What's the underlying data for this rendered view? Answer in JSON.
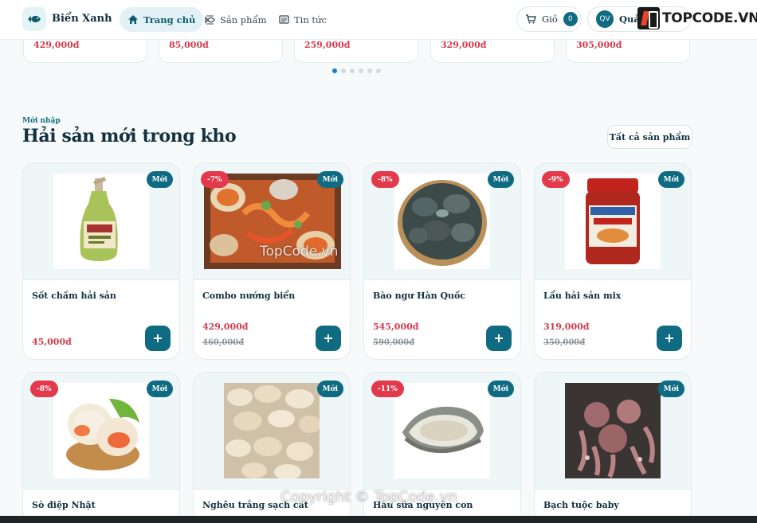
{
  "header": {
    "brand": "Biển Xanh",
    "nav": [
      {
        "label": "Trang chủ",
        "icon": "home-icon"
      },
      {
        "label": "Sản phẩm",
        "icon": "fish-icon"
      },
      {
        "label": "Tin tức",
        "icon": "newspaper-icon"
      }
    ],
    "cart_label": "Giỏ",
    "cart_count": "0",
    "avatar_initials": "QV",
    "user_label": "Quản"
  },
  "watermark": {
    "logo_text": "TOPCODE.VN",
    "center": "TopCode.vn",
    "footer": "Copyright © TopCode.vn"
  },
  "carousel": {
    "prices": [
      "429,000đ",
      "85,000đ",
      "259,000đ",
      "329,000đ",
      "305,000đ"
    ],
    "dot_count": 6,
    "active_dot": 0
  },
  "section": {
    "eyebrow": "Mới nhập",
    "title": "Hải sản mới trong kho",
    "all_button": "Tất cả sản phẩm"
  },
  "colors": {
    "primary": "#0f6b82",
    "sale": "#e2394b",
    "price": "#d43b4d"
  },
  "products": [
    {
      "name": "Sốt chấm hải sản",
      "badge_new": "Mới",
      "discount": "",
      "price": "45,000đ",
      "old_price": ""
    },
    {
      "name": "Combo nướng biển",
      "badge_new": "Mới",
      "discount": "-7%",
      "price": "429,000đ",
      "old_price": "460,000đ"
    },
    {
      "name": "Bào ngư Hàn Quốc",
      "badge_new": "Mới",
      "discount": "-8%",
      "price": "545,000đ",
      "old_price": "590,000đ"
    },
    {
      "name": "Lẩu hải sản mix",
      "badge_new": "Mới",
      "discount": "-9%",
      "price": "319,000đ",
      "old_price": "350,000đ"
    },
    {
      "name": "Sò điệp Nhật",
      "badge_new": "Mới",
      "discount": "-8%",
      "price": "",
      "old_price": ""
    },
    {
      "name": "Nghêu trắng sạch cát",
      "badge_new": "Mới",
      "discount": "",
      "price": "",
      "old_price": ""
    },
    {
      "name": "Hàu sữa nguyên con",
      "badge_new": "Mới",
      "discount": "-11%",
      "price": "",
      "old_price": ""
    },
    {
      "name": "Bạch tuộc baby",
      "badge_new": "Mới",
      "discount": "",
      "price": "",
      "old_price": ""
    }
  ]
}
